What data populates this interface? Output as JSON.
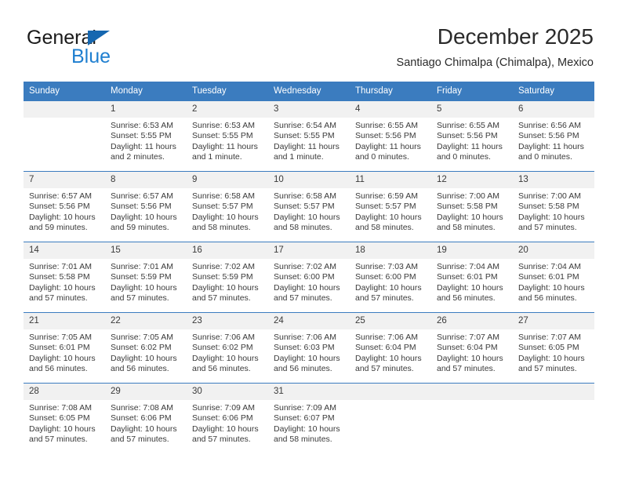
{
  "brand": {
    "name_part1": "General",
    "name_part2": "Blue",
    "accent_color": "#1f7fd0",
    "triangle_color": "#1567b0",
    "triangle_icon": "triangle-logo-icon"
  },
  "header": {
    "month_title": "December 2025",
    "location": "Santiago Chimalpa (Chimalpa), Mexico"
  },
  "calendar": {
    "header_bg": "#3b7cbf",
    "daynum_bg": "#f1f1f1",
    "weekdays": [
      "Sunday",
      "Monday",
      "Tuesday",
      "Wednesday",
      "Thursday",
      "Friday",
      "Saturday"
    ],
    "weeks": [
      [
        {
          "day": "",
          "lines": []
        },
        {
          "day": "1",
          "lines": [
            "Sunrise: 6:53 AM",
            "Sunset: 5:55 PM",
            "Daylight: 11 hours",
            "and 2 minutes."
          ]
        },
        {
          "day": "2",
          "lines": [
            "Sunrise: 6:53 AM",
            "Sunset: 5:55 PM",
            "Daylight: 11 hours",
            "and 1 minute."
          ]
        },
        {
          "day": "3",
          "lines": [
            "Sunrise: 6:54 AM",
            "Sunset: 5:55 PM",
            "Daylight: 11 hours",
            "and 1 minute."
          ]
        },
        {
          "day": "4",
          "lines": [
            "Sunrise: 6:55 AM",
            "Sunset: 5:56 PM",
            "Daylight: 11 hours",
            "and 0 minutes."
          ]
        },
        {
          "day": "5",
          "lines": [
            "Sunrise: 6:55 AM",
            "Sunset: 5:56 PM",
            "Daylight: 11 hours",
            "and 0 minutes."
          ]
        },
        {
          "day": "6",
          "lines": [
            "Sunrise: 6:56 AM",
            "Sunset: 5:56 PM",
            "Daylight: 11 hours",
            "and 0 minutes."
          ]
        }
      ],
      [
        {
          "day": "7",
          "lines": [
            "Sunrise: 6:57 AM",
            "Sunset: 5:56 PM",
            "Daylight: 10 hours",
            "and 59 minutes."
          ]
        },
        {
          "day": "8",
          "lines": [
            "Sunrise: 6:57 AM",
            "Sunset: 5:56 PM",
            "Daylight: 10 hours",
            "and 59 minutes."
          ]
        },
        {
          "day": "9",
          "lines": [
            "Sunrise: 6:58 AM",
            "Sunset: 5:57 PM",
            "Daylight: 10 hours",
            "and 58 minutes."
          ]
        },
        {
          "day": "10",
          "lines": [
            "Sunrise: 6:58 AM",
            "Sunset: 5:57 PM",
            "Daylight: 10 hours",
            "and 58 minutes."
          ]
        },
        {
          "day": "11",
          "lines": [
            "Sunrise: 6:59 AM",
            "Sunset: 5:57 PM",
            "Daylight: 10 hours",
            "and 58 minutes."
          ]
        },
        {
          "day": "12",
          "lines": [
            "Sunrise: 7:00 AM",
            "Sunset: 5:58 PM",
            "Daylight: 10 hours",
            "and 58 minutes."
          ]
        },
        {
          "day": "13",
          "lines": [
            "Sunrise: 7:00 AM",
            "Sunset: 5:58 PM",
            "Daylight: 10 hours",
            "and 57 minutes."
          ]
        }
      ],
      [
        {
          "day": "14",
          "lines": [
            "Sunrise: 7:01 AM",
            "Sunset: 5:58 PM",
            "Daylight: 10 hours",
            "and 57 minutes."
          ]
        },
        {
          "day": "15",
          "lines": [
            "Sunrise: 7:01 AM",
            "Sunset: 5:59 PM",
            "Daylight: 10 hours",
            "and 57 minutes."
          ]
        },
        {
          "day": "16",
          "lines": [
            "Sunrise: 7:02 AM",
            "Sunset: 5:59 PM",
            "Daylight: 10 hours",
            "and 57 minutes."
          ]
        },
        {
          "day": "17",
          "lines": [
            "Sunrise: 7:02 AM",
            "Sunset: 6:00 PM",
            "Daylight: 10 hours",
            "and 57 minutes."
          ]
        },
        {
          "day": "18",
          "lines": [
            "Sunrise: 7:03 AM",
            "Sunset: 6:00 PM",
            "Daylight: 10 hours",
            "and 57 minutes."
          ]
        },
        {
          "day": "19",
          "lines": [
            "Sunrise: 7:04 AM",
            "Sunset: 6:01 PM",
            "Daylight: 10 hours",
            "and 56 minutes."
          ]
        },
        {
          "day": "20",
          "lines": [
            "Sunrise: 7:04 AM",
            "Sunset: 6:01 PM",
            "Daylight: 10 hours",
            "and 56 minutes."
          ]
        }
      ],
      [
        {
          "day": "21",
          "lines": [
            "Sunrise: 7:05 AM",
            "Sunset: 6:01 PM",
            "Daylight: 10 hours",
            "and 56 minutes."
          ]
        },
        {
          "day": "22",
          "lines": [
            "Sunrise: 7:05 AM",
            "Sunset: 6:02 PM",
            "Daylight: 10 hours",
            "and 56 minutes."
          ]
        },
        {
          "day": "23",
          "lines": [
            "Sunrise: 7:06 AM",
            "Sunset: 6:02 PM",
            "Daylight: 10 hours",
            "and 56 minutes."
          ]
        },
        {
          "day": "24",
          "lines": [
            "Sunrise: 7:06 AM",
            "Sunset: 6:03 PM",
            "Daylight: 10 hours",
            "and 56 minutes."
          ]
        },
        {
          "day": "25",
          "lines": [
            "Sunrise: 7:06 AM",
            "Sunset: 6:04 PM",
            "Daylight: 10 hours",
            "and 57 minutes."
          ]
        },
        {
          "day": "26",
          "lines": [
            "Sunrise: 7:07 AM",
            "Sunset: 6:04 PM",
            "Daylight: 10 hours",
            "and 57 minutes."
          ]
        },
        {
          "day": "27",
          "lines": [
            "Sunrise: 7:07 AM",
            "Sunset: 6:05 PM",
            "Daylight: 10 hours",
            "and 57 minutes."
          ]
        }
      ],
      [
        {
          "day": "28",
          "lines": [
            "Sunrise: 7:08 AM",
            "Sunset: 6:05 PM",
            "Daylight: 10 hours",
            "and 57 minutes."
          ]
        },
        {
          "day": "29",
          "lines": [
            "Sunrise: 7:08 AM",
            "Sunset: 6:06 PM",
            "Daylight: 10 hours",
            "and 57 minutes."
          ]
        },
        {
          "day": "30",
          "lines": [
            "Sunrise: 7:09 AM",
            "Sunset: 6:06 PM",
            "Daylight: 10 hours",
            "and 57 minutes."
          ]
        },
        {
          "day": "31",
          "lines": [
            "Sunrise: 7:09 AM",
            "Sunset: 6:07 PM",
            "Daylight: 10 hours",
            "and 58 minutes."
          ]
        },
        {
          "day": "",
          "lines": []
        },
        {
          "day": "",
          "lines": []
        },
        {
          "day": "",
          "lines": []
        }
      ]
    ]
  }
}
